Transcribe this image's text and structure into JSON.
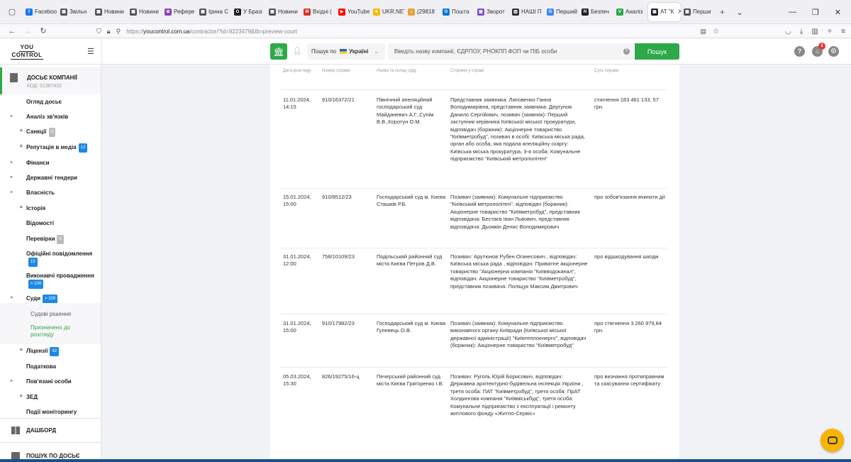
{
  "browser": {
    "tabs": [
      {
        "label": "Faceboo",
        "color": "#1877f2",
        "glyph": "f"
      },
      {
        "label": "Звільн",
        "color": "#555555",
        "glyph": "▦"
      },
      {
        "label": "Новини",
        "color": "#555555",
        "glyph": "▦"
      },
      {
        "label": "Новини",
        "color": "#555555",
        "glyph": "▦"
      },
      {
        "label": "Рефере",
        "color": "#8e44ad",
        "glyph": "✿"
      },
      {
        "label": "Ірина С",
        "color": "#555555",
        "glyph": "▦"
      },
      {
        "label": "У Бразі",
        "color": "#222222",
        "glyph": "G"
      },
      {
        "label": "Новини",
        "color": "#555555",
        "glyph": "▦"
      },
      {
        "label": "Вхідні (",
        "color": "#d93025",
        "glyph": "M"
      },
      {
        "label": "YouTube",
        "color": "#ff0000",
        "glyph": "▶"
      },
      {
        "label": "UKR.NET",
        "color": "#f5b800",
        "glyph": "★"
      },
      {
        "label": "(29818",
        "color": "#e8a33b",
        "glyph": "⌂"
      },
      {
        "label": "Пошта",
        "color": "#0078d4",
        "glyph": "O"
      },
      {
        "label": "Зворот",
        "color": "#7b4fc9",
        "glyph": "▣"
      },
      {
        "label": "НАШІ П",
        "color": "#333333",
        "glyph": "▥"
      },
      {
        "label": "Перший",
        "color": "#4285f4",
        "glyph": "G"
      },
      {
        "label": "Безпеч",
        "color": "#222222",
        "glyph": "N"
      },
      {
        "label": "Аналіз",
        "color": "#2ea84a",
        "glyph": "V"
      },
      {
        "label": "АТ \"К",
        "color": "#222222",
        "glyph": "▣",
        "active": true
      },
      {
        "label": "Перши",
        "color": "#555555",
        "glyph": "▦"
      }
    ],
    "url_prefix": "https://",
    "url_domain": "youcontrol.com.ua",
    "url_path": "/contractor/?id=9223479&tb=preview-court"
  },
  "header": {
    "logo_top": "YOU",
    "logo_bottom": "CONTROL",
    "scope_label": "Пошук по",
    "scope_value": "Україні",
    "search_placeholder": "Введіть назву компанії, ЄДРПОУ, РНОКПП ФОП чи ПІБ особи",
    "search_button": "Пошук",
    "help_glyph": "?",
    "notifications_count": "1"
  },
  "sidebar": {
    "dossier_title": "ДОСЬЄ КОМПАНІЇ",
    "dossier_code": "КОД: 01387432",
    "items": [
      {
        "label": "Огляд досьє",
        "arrow": false,
        "lock": false
      },
      {
        "label": "Аналіз зв'язків",
        "arrow": true,
        "lock": false
      },
      {
        "label": "Санкції",
        "arrow": false,
        "lock": true,
        "badge": "0",
        "badge_type": "gray"
      },
      {
        "label": "Репутація в медіа",
        "arrow": false,
        "lock": true,
        "badge": "12",
        "badge_type": "blue"
      },
      {
        "label": "Фінанси",
        "arrow": true,
        "lock": false
      },
      {
        "label": "Державні тендери",
        "arrow": true,
        "lock": false
      },
      {
        "label": "Власність",
        "arrow": true,
        "lock": false
      },
      {
        "label": "Історія",
        "arrow": false,
        "lock": true
      },
      {
        "label": "Відомості",
        "arrow": false,
        "lock": false
      },
      {
        "label": "Перевірки",
        "arrow": false,
        "lock": false,
        "badge": "0",
        "badge_type": "gray"
      },
      {
        "label": "Офіційні повідомлення",
        "arrow": false,
        "lock": false,
        "badge": "15",
        "badge_type": "blue"
      },
      {
        "label": "Виконавчі провадження",
        "arrow": false,
        "lock": false,
        "badge": "> 100",
        "badge_type": "blue"
      },
      {
        "label": "Суди",
        "arrow": true,
        "lock": false,
        "badge": "> 100",
        "badge_type": "blue",
        "expanded": true
      }
    ],
    "sub_items": [
      {
        "label": "Судові рішення"
      },
      {
        "label": "Призначено до розгляду",
        "active": true
      }
    ],
    "items_after": [
      {
        "label": "Ліцензії",
        "arrow": false,
        "lock": true,
        "badge": "42",
        "badge_type": "blue"
      },
      {
        "label": "Податкова",
        "arrow": false,
        "lock": false
      },
      {
        "label": "Пов'язані особи",
        "arrow": true,
        "lock": false
      },
      {
        "label": "ЗЕД",
        "arrow": false,
        "lock": true
      },
      {
        "label": "Події моніторингу",
        "arrow": false,
        "lock": false
      }
    ],
    "dashboard": "ДАШБОРД",
    "dossier_search": "ПОШУК ПО ДОСЬЄ"
  },
  "table": {
    "headers": {
      "date": "Дата розгляду",
      "number": "Номер справи",
      "court": "Назва та склад суду",
      "sides": "Сторони у справі",
      "subject": "Суть справи"
    },
    "rows": [
      {
        "date": "11.01.2024, 14:15",
        "number": "910/16372/21",
        "court": "Північний апеляційний господарський суд Майданевич А.Г.,Сулім В.В.,Коротун О.М.",
        "sides": "Представник заявника: Липовенко Ганна Володимирівна, представник заявника: Дергунов Данило Сергійович, позивач (заявник): Перший заступник керівника Київської міської прокуратури, відповідач (боржник): Акціонерне товариство \"Київметробуд\", позивач в особі: Київська міська рада, орган або особа, яка подала апеляційну скаргу: Київська міська прокуратура, 3-я особа: Комунальне підприємство \"Київський метрополітен\"",
        "subject": "стягнення 183 461 133, 57 грн."
      },
      {
        "date": "15.01.2024, 15:00",
        "number": "910/8512/23",
        "court": "Господарський суд м. Києва Сташків Р.Б.",
        "sides": "Позивач (заявник): Комунальне підприємство \"Київський метрополітен\", відповідач (боржник): Акціонерне товариство \"Київметробуд\", представник відповідача: Бестаєв Іван Львович, представник відповідача: Дьомкін Денис Володимирович",
        "subject": "про зобов'язання вчинити дії"
      },
      {
        "date": "31.01.2024, 12:00",
        "number": "758/10109/23",
        "court": "Подільський районний суд міста Києва Петров Д.В.",
        "sides": "Позивач: Арутюнов Рубен Оганесович , відповідач: Київська міська рада , відповідач: Приватне акціонерне товариство \"Акціонерна компанія \"Київводоканал\", відповідач: Акціонерне товариство \"Київметробуд\", представник позивача: Поліщук Максим Дмитрович",
        "subject": "про відшкодування шкоди"
      },
      {
        "date": "31.01.2024, 15:00",
        "number": "910/17982/23",
        "court": "Господарський суд м. Києва Гулевець О.В.",
        "sides": "Позивач (заявник): Комунальне підприємство виконавчого органу Київради (Київської міської державної адміністрації) \"Київтеплоенерго\", відповідач (боржник): Акціонерне товариство \"Київметробуд\"",
        "subject": "про стягнення 3 260 979,84 грн."
      },
      {
        "date": "05.03.2024, 15:30",
        "number": "826/19275/16-ц",
        "court": "Печерський районний суд міста Києва Григоренко І.В.",
        "sides": "Позивач: Руголь Юрій Борисович, відповідач: Державна архітектурно-будівельна інспекція України , третя особа: ПАТ \"Київметробуд\", третя особа: ПрАТ Холдингова компанія \"Київміськбуд\", третя особа: Комунальне підприємство з експлуатації і ремонту житлового фонду «Житло-Сервіс»",
        "subject": "про визнання протиправним та скасування сертифікату"
      }
    ]
  }
}
